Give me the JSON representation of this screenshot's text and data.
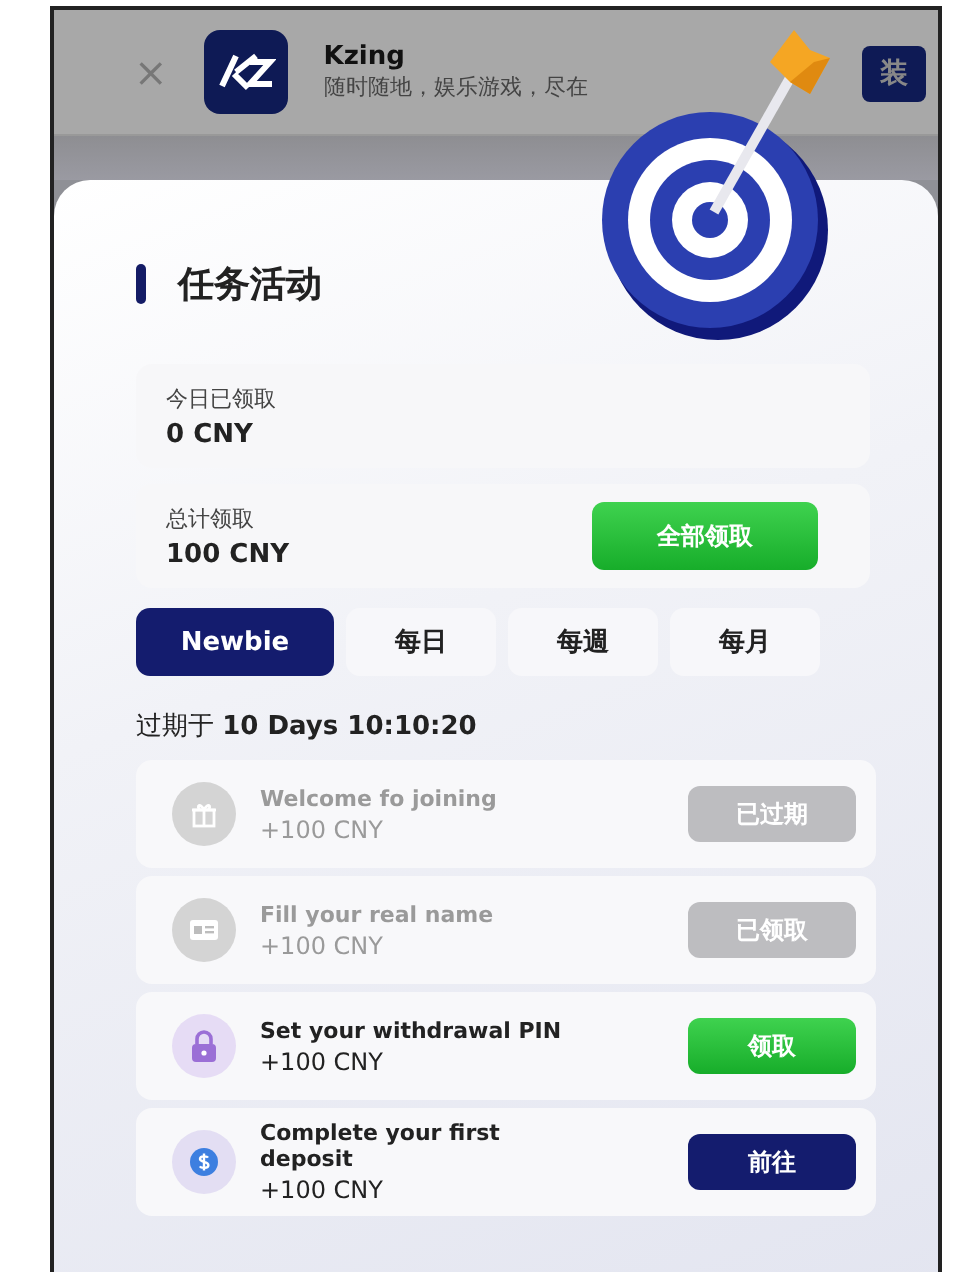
{
  "banner": {
    "close": "×",
    "app_name": "Kzing",
    "tagline": "随时随地，娱乐游戏，尽在",
    "button": "装"
  },
  "panel": {
    "title": "任务活动",
    "today": {
      "label": "今日已领取",
      "value": "0 CNY"
    },
    "total": {
      "label": "总计领取",
      "value": "100 CNY",
      "button": "全部领取"
    },
    "tabs": [
      {
        "label": "Newbie",
        "selected": true
      },
      {
        "label": "每日",
        "selected": false
      },
      {
        "label": "每週",
        "selected": false
      },
      {
        "label": "每月",
        "selected": false
      }
    ],
    "expiry": "过期于 **10 Days 10:10:20**",
    "tasks": [
      {
        "title": "Welcome fo joining",
        "reward": "+100 CNY",
        "kind": "expired",
        "button": "已过期"
      },
      {
        "title": "Fill your real name",
        "reward": "+100 CNY",
        "kind": "claimed",
        "button": "已领取"
      },
      {
        "title": "Set your withdrawal PIN",
        "reward": "+100 CNY",
        "kind": "claimable",
        "button": "领取"
      },
      {
        "title": "Complete your first deposit",
        "reward": "+100 CNY",
        "kind": "go",
        "button": "前往"
      }
    ]
  }
}
